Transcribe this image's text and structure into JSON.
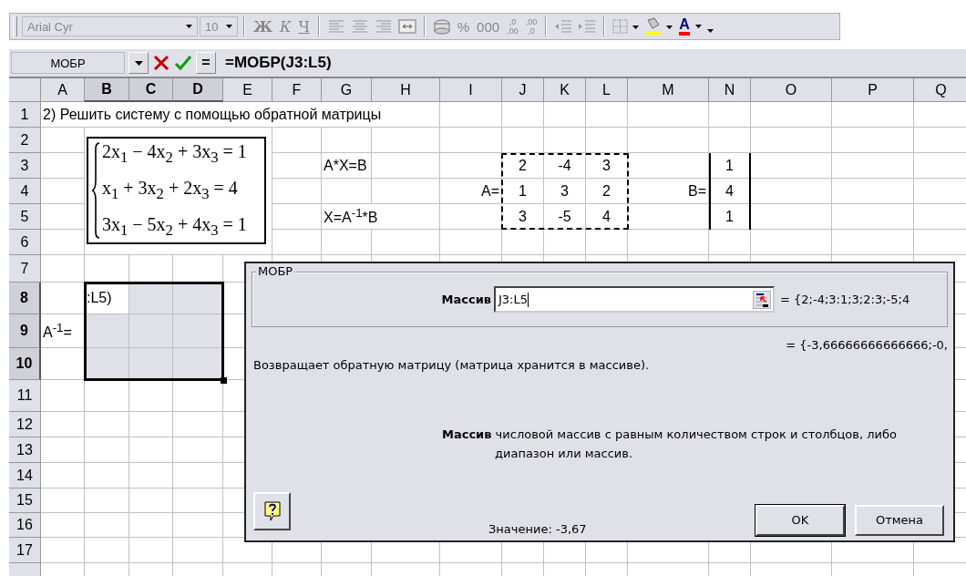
{
  "toolbar": {
    "font": "Arial Cyr",
    "size": "10",
    "groups": [
      [
        {
          "kind": "bold",
          "label": "Ж"
        },
        {
          "kind": "italic",
          "label": "К"
        },
        {
          "kind": "underline",
          "label": "Ч"
        }
      ],
      [
        {
          "kind": "align-left"
        },
        {
          "kind": "align-center"
        },
        {
          "kind": "align-right"
        },
        {
          "kind": "merge"
        }
      ],
      [
        {
          "kind": "currency"
        },
        {
          "kind": "text",
          "label": "%"
        },
        {
          "kind": "text",
          "label": "000"
        },
        {
          "kind": "decimal",
          "label": ",0",
          "sub": ",00"
        },
        {
          "kind": "decimal",
          "label": ",00",
          "sub": ",0"
        }
      ],
      [
        {
          "kind": "outdent"
        },
        {
          "kind": "indent"
        }
      ],
      [
        {
          "kind": "borders"
        },
        {
          "kind": "fill",
          "color": "#ffff00"
        },
        {
          "kind": "font-color",
          "label": "A",
          "color": "#ff0000"
        },
        {
          "kind": "options"
        }
      ]
    ]
  },
  "formula_bar": {
    "name_box": "МОБР",
    "equals": "=",
    "formula": "=МОБР(J3:L5)"
  },
  "sheet": {
    "columns": [
      {
        "label": "A",
        "selected": false
      },
      {
        "label": "B",
        "selected": true
      },
      {
        "label": "C",
        "selected": true
      },
      {
        "label": "D",
        "selected": true
      },
      {
        "label": "E",
        "selected": false
      },
      {
        "label": "F",
        "selected": false
      },
      {
        "label": "G",
        "selected": false
      },
      {
        "label": "H",
        "selected": false
      },
      {
        "label": "I",
        "selected": false
      },
      {
        "label": "J",
        "selected": false
      },
      {
        "label": "K",
        "selected": false
      },
      {
        "label": "L",
        "selected": false
      },
      {
        "label": "M",
        "selected": false
      },
      {
        "label": "N",
        "selected": false
      },
      {
        "label": "O",
        "selected": false
      },
      {
        "label": "P",
        "selected": false
      },
      {
        "label": "Q",
        "selected": false
      }
    ],
    "rows": [
      {
        "label": "1",
        "selected": false,
        "cells": {
          "A": "2) Решить систему с помощью обратной матрицы"
        }
      },
      {
        "label": "2",
        "selected": false,
        "cells": {}
      },
      {
        "label": "3",
        "selected": false,
        "cells": {
          "G": "A*X=B",
          "J": "2",
          "K": "-4",
          "L": "3",
          "N": "1"
        }
      },
      {
        "label": "4",
        "selected": false,
        "cells": {
          "I": "A=",
          "J": "1",
          "K": "3",
          "L": "2",
          "M": "B=",
          "N": "4"
        }
      },
      {
        "label": "5",
        "selected": false,
        "cells": {
          "G": "X=A$^{-1}$*B",
          "J": "3",
          "K": "-5",
          "L": "4",
          "N": "1"
        }
      },
      {
        "label": "6",
        "selected": false,
        "cells": {}
      },
      {
        "label": "7",
        "selected": false,
        "cells": {}
      },
      {
        "label": "8",
        "selected": true,
        "cells": {
          "B": ":L5)"
        }
      },
      {
        "label": "9",
        "selected": true,
        "cells": {
          "A": "A$^{-1}$="
        }
      },
      {
        "label": "10",
        "selected": true,
        "cells": {}
      },
      {
        "label": "11",
        "selected": false,
        "cells": {}
      },
      {
        "label": "12",
        "selected": false,
        "cells": {}
      },
      {
        "label": "13",
        "selected": false,
        "cells": {}
      },
      {
        "label": "14",
        "selected": false,
        "cells": {}
      },
      {
        "label": "15",
        "selected": false,
        "cells": {}
      },
      {
        "label": "16",
        "selected": false,
        "cells": {}
      },
      {
        "label": "17",
        "selected": false,
        "cells": {}
      }
    ],
    "equations": [
      "2x$_{1}$ − 4x$_{2}$ + 3x$_{3}$ = 1",
      "x$_{1}$ + 3x$_{2}$ + 2x$_{3}$ = 4",
      "3x$_{1}$ − 5x$_{2}$ + 4x$_{3}$ = 1"
    ]
  },
  "dialog": {
    "title": "МОБР",
    "argument": {
      "label": "Массив",
      "value": "J3:L5",
      "result": "= {2;-4;3:1;3;2:3;-5;4"
    },
    "result": "= {-3,66666666666666;-0,",
    "description": "Возвращает обратную матрицу (матрица хранится в массиве).",
    "argument_help": "**Массив** числовой массив с равным количеством строк и столбцов, либо диапазон или массив.",
    "value": "Значение: -3,67",
    "buttons": [
      {
        "label": "OK",
        "default": true
      },
      {
        "label": "Отмена",
        "default": false
      }
    ]
  }
}
